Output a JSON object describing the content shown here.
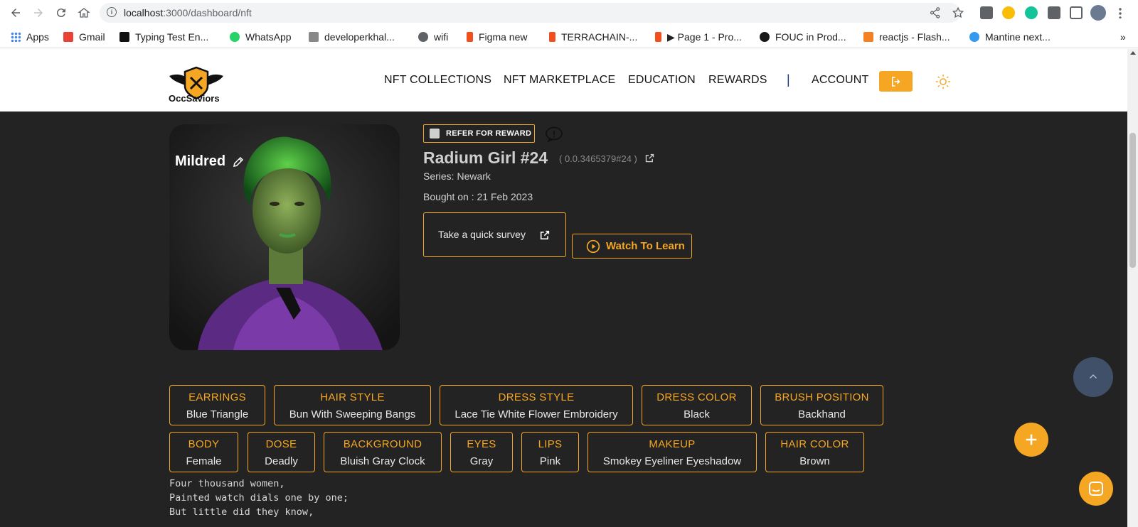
{
  "browser": {
    "url_host": "localhost",
    "url_path": ":3000/dashboard/nft",
    "bookmarks": [
      {
        "label": "Apps",
        "color": "#4285f4"
      },
      {
        "label": "Gmail",
        "color": "#ea4335"
      },
      {
        "label": "Typing Test En...",
        "color": "#111111"
      },
      {
        "label": "WhatsApp",
        "color": "#25d366"
      },
      {
        "label": "developerkhal...",
        "color": "#888888"
      },
      {
        "label": "wifi",
        "color": "#5f6368"
      },
      {
        "label": "Figma new",
        "color": "#f24e1e"
      },
      {
        "label": "TERRACHAIN-...",
        "color": "#f24e1e"
      },
      {
        "label": "▶ Page 1 - Pro...",
        "color": "#f24e1e"
      },
      {
        "label": "FOUC in Prod...",
        "color": "#181717"
      },
      {
        "label": "reactjs - Flash...",
        "color": "#f48024"
      },
      {
        "label": "Mantine next...",
        "color": "#339af0"
      }
    ],
    "more": "»"
  },
  "header": {
    "logo_text": "OccSaviors",
    "nav": [
      "NFT COLLECTIONS",
      "NFT MARKETPLACE",
      "EDUCATION",
      "REWARDS"
    ],
    "separator": "|",
    "account": "ACCOUNT"
  },
  "nft": {
    "name": "Mildred",
    "refer_label": "REFER FOR REWARD",
    "title": "Radium Girl #24",
    "token_id": "( 0.0.3465379#24 )",
    "series": "Series: Newark",
    "bought": "Bought on : 21 Feb 2023",
    "survey_label": "Take a quick survey",
    "watch_label": "Watch To Learn"
  },
  "attributes_row1": [
    {
      "key": "EARRINGS",
      "value": "Blue Triangle"
    },
    {
      "key": "HAIR STYLE",
      "value": "Bun With Sweeping Bangs"
    },
    {
      "key": "DRESS STYLE",
      "value": "Lace Tie White Flower Embroidery"
    },
    {
      "key": "DRESS COLOR",
      "value": "Black"
    },
    {
      "key": "BRUSH POSITION",
      "value": "Backhand"
    }
  ],
  "attributes_row2": [
    {
      "key": "BODY",
      "value": "Female"
    },
    {
      "key": "DOSE",
      "value": "Deadly"
    },
    {
      "key": "BACKGROUND",
      "value": "Bluish Gray Clock"
    },
    {
      "key": "EYES",
      "value": "Gray"
    },
    {
      "key": "LIPS",
      "value": "Pink"
    },
    {
      "key": "MAKEUP",
      "value": "Smokey Eyeliner Eyeshadow"
    },
    {
      "key": "HAIR COLOR",
      "value": "Brown"
    }
  ],
  "poem": [
    "Four thousand women,",
    "Painted watch dials one by one;",
    "But little did they know,"
  ],
  "colors": {
    "accent": "#f5a623",
    "background": "#232323"
  }
}
